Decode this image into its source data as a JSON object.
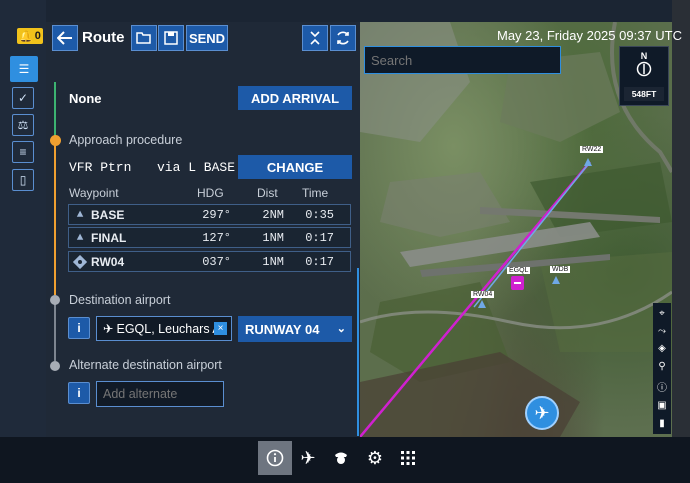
{
  "alerts": {
    "count": "0"
  },
  "header": {
    "title": "Route",
    "send_label": "SEND"
  },
  "route": {
    "arrival_value": "None",
    "add_arrival_label": "ADD ARRIVAL",
    "approach_label": "Approach procedure",
    "approach_name": "VFR Ptrn",
    "approach_via": "via L BASE",
    "change_label": "CHANGE",
    "table_headers": {
      "waypoint": "Waypoint",
      "hdg": "HDG",
      "dist": "Dist",
      "time": "Time"
    },
    "waypoints": [
      {
        "name": "BASE",
        "hdg": "297°",
        "dist": "2NM",
        "time": "0:35"
      },
      {
        "name": "FINAL",
        "hdg": "127°",
        "dist": "1NM",
        "time": "0:17"
      },
      {
        "name": "RW04",
        "hdg": "037°",
        "dist": "1NM",
        "time": "0:17"
      }
    ],
    "destination_label": "Destination airport",
    "destination_value": "EGQL, Leuchars A",
    "runway_label": "RUNWAY 04",
    "alternate_label": "Alternate destination airport",
    "alternate_placeholder": "Add alternate"
  },
  "map": {
    "datetime": "May 23, Friday 2025 09:37 UTC",
    "search_placeholder": "Search",
    "compass_label": "N",
    "altitude": "548FT",
    "labels": {
      "rw22": "RW22",
      "egql": "EGQL",
      "wdb": "WDB",
      "rw04": "RW04"
    }
  },
  "colors": {
    "accent": "#1d5aa8",
    "route_line": "#d020d0",
    "timeline_green": "#3cb371",
    "timeline_orange": "#f0a030"
  }
}
